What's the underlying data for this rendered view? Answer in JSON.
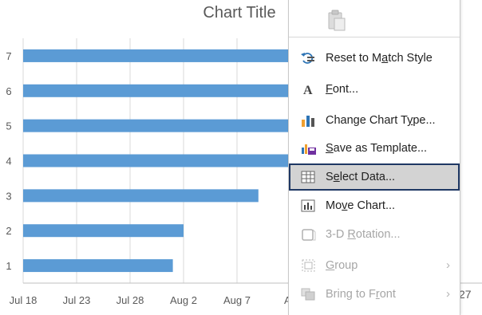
{
  "chart_data": {
    "type": "bar",
    "orientation": "horizontal",
    "title": "Chart Title",
    "categories": [
      "1",
      "2",
      "3",
      "4",
      "5",
      "6",
      "7"
    ],
    "series": [
      {
        "color": "#5b9bd5",
        "values": [
          "2020-08-01",
          "2020-08-02",
          "2020-08-09",
          "2020-08-18",
          "2020-08-27",
          "2020-08-27",
          "2020-08-27"
        ]
      }
    ],
    "x_axis": {
      "type": "date",
      "start": "2020-07-18",
      "ticks": [
        "Jul 18",
        "Jul 23",
        "Jul 28",
        "Aug 2",
        "Aug 7",
        "Au"
      ]
    },
    "grid": true,
    "legend": "none"
  },
  "right_edge_label": "27",
  "context_menu": {
    "items": [
      {
        "id": "reset",
        "pre": "Reset to M",
        "u": "a",
        "post": "tch Style",
        "icon": "reset-style-icon",
        "enabled": true,
        "submenu": false
      },
      {
        "id": "font",
        "pre": "",
        "u": "F",
        "post": "ont...",
        "icon": "font-icon",
        "enabled": true,
        "submenu": false
      },
      {
        "id": "change-type",
        "pre": "Change Chart T",
        "u": "y",
        "post": "pe...",
        "icon": "change-chart-type-icon",
        "enabled": true,
        "submenu": false
      },
      {
        "id": "save-template",
        "pre": "",
        "u": "S",
        "post": "ave as Template...",
        "icon": "save-template-icon",
        "enabled": true,
        "submenu": false
      },
      {
        "id": "select-data",
        "pre": "S",
        "u": "e",
        "post": "lect Data...",
        "icon": "select-data-icon",
        "enabled": true,
        "submenu": false,
        "selected": true
      },
      {
        "id": "move-chart",
        "pre": "Mo",
        "u": "v",
        "post": "e Chart...",
        "icon": "move-chart-icon",
        "enabled": true,
        "submenu": false
      },
      {
        "id": "rotation",
        "pre": "3-D ",
        "u": "R",
        "post": "otation...",
        "icon": "rotation-3d-icon",
        "enabled": false,
        "submenu": false
      },
      {
        "id": "group",
        "pre": "",
        "u": "G",
        "post": "roup",
        "icon": "group-icon",
        "enabled": false,
        "submenu": true
      },
      {
        "id": "front",
        "pre": "Bring to F",
        "u": "r",
        "post": "ont",
        "icon": "bring-front-icon",
        "enabled": false,
        "submenu": true
      }
    ],
    "submenu_arrow": "›"
  }
}
